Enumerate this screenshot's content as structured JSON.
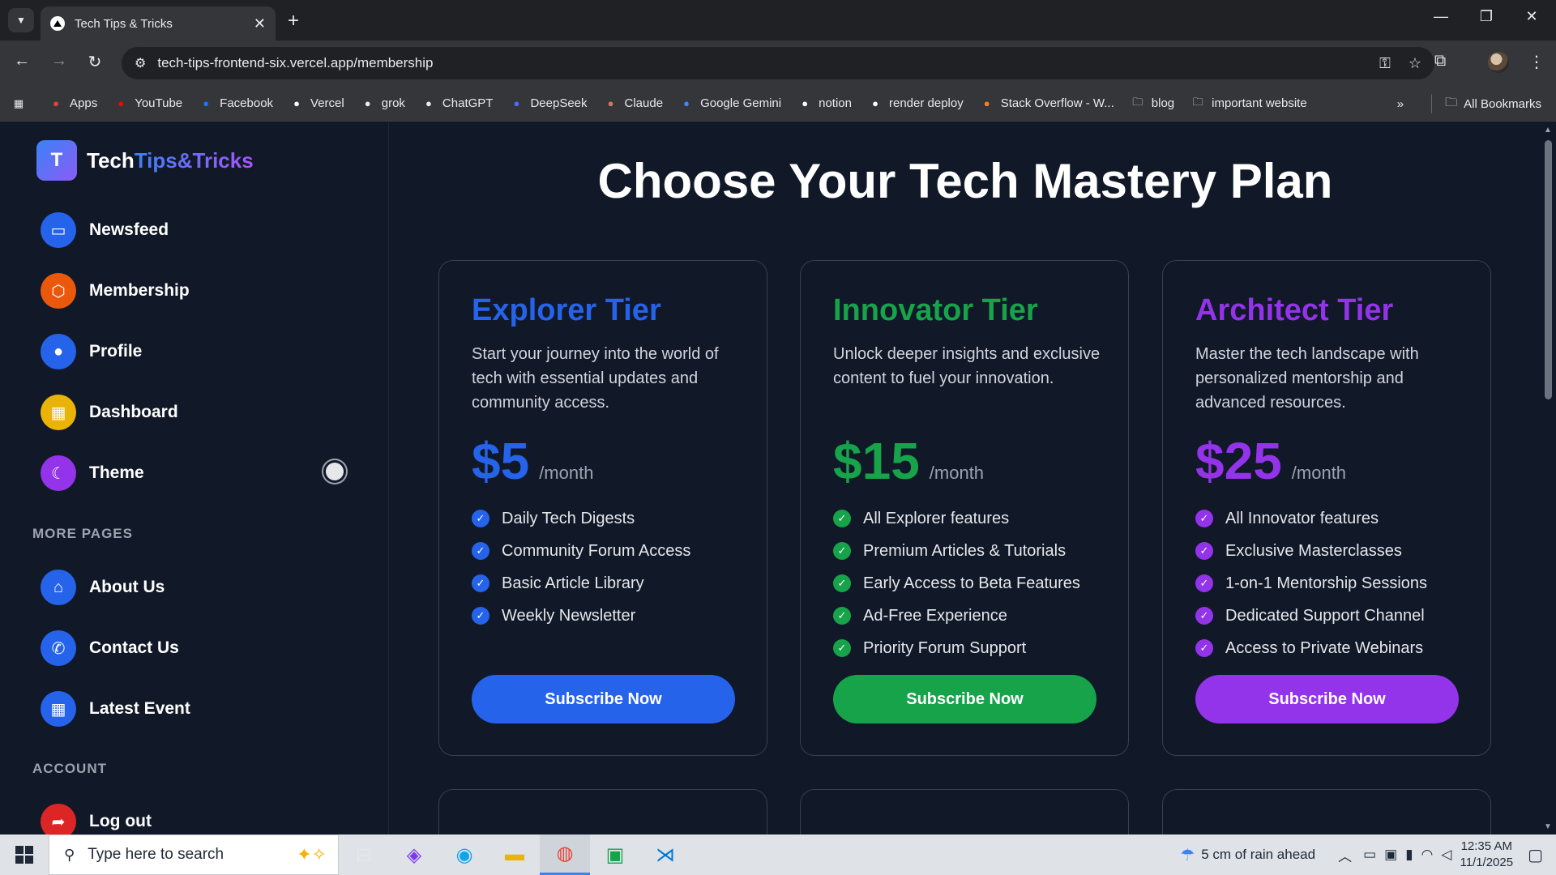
{
  "browser": {
    "tab_title": "Tech Tips & Tricks",
    "url": "tech-tips-frontend-six.vercel.app/membership",
    "bookmarks": [
      {
        "label": "Apps",
        "icon": "apps-grid-icon",
        "color": "#ea4335"
      },
      {
        "label": "YouTube",
        "icon": "youtube-icon",
        "color": "#ff0000"
      },
      {
        "label": "Facebook",
        "icon": "facebook-icon",
        "color": "#1877f2"
      },
      {
        "label": "Vercel",
        "icon": "vercel-icon",
        "color": "#ffffff"
      },
      {
        "label": "grok",
        "icon": "grok-icon",
        "color": "#e8eaed"
      },
      {
        "label": "ChatGPT",
        "icon": "chatgpt-icon",
        "color": "#e8eaed"
      },
      {
        "label": "DeepSeek",
        "icon": "deepseek-icon",
        "color": "#4d6bfe"
      },
      {
        "label": "Claude",
        "icon": "claude-icon",
        "color": "#d97757"
      },
      {
        "label": "Google Gemini",
        "icon": "gemini-icon",
        "color": "#4285f4"
      },
      {
        "label": "notion",
        "icon": "notion-icon",
        "color": "#ffffff"
      },
      {
        "label": "render deploy",
        "icon": "render-icon",
        "color": "#ffffff"
      },
      {
        "label": "Stack Overflow - W...",
        "icon": "stackoverflow-icon",
        "color": "#f48024"
      },
      {
        "label": "blog",
        "icon": "folder-icon",
        "color": "#e8eaed"
      },
      {
        "label": "important website",
        "icon": "folder-icon",
        "color": "#e8eaed"
      }
    ],
    "all_bookmarks": "All Bookmarks"
  },
  "sidebar": {
    "brand_part1": "Tech",
    "brand_part2": "Tips&Tricks",
    "logo_letter": "T",
    "items": [
      {
        "label": "Newsfeed",
        "icon": "monitor-icon",
        "color": "#2563eb"
      },
      {
        "label": "Membership",
        "icon": "cube-icon",
        "color": "#ea580c"
      },
      {
        "label": "Profile",
        "icon": "user-circle-icon",
        "color": "#2563eb"
      },
      {
        "label": "Dashboard",
        "icon": "grid-icon",
        "color": "#eab308"
      },
      {
        "label": "Theme",
        "icon": "moon-icon",
        "color": "#9333ea"
      }
    ],
    "more_pages_title": "MORE PAGES",
    "more_pages": [
      {
        "label": "About Us",
        "icon": "home-hand-icon",
        "color": "#2563eb"
      },
      {
        "label": "Contact Us",
        "icon": "phone-icon",
        "color": "#2563eb"
      },
      {
        "label": "Latest Event",
        "icon": "calendar-icon",
        "color": "#2563eb"
      }
    ],
    "account_title": "ACCOUNT",
    "logout": {
      "label": "Log out",
      "icon": "logout-icon",
      "color": "#dc2626"
    }
  },
  "main": {
    "heading": "Choose Your Tech Mastery Plan",
    "tiers": [
      {
        "name": "Explorer Tier",
        "color": "#2563eb",
        "description": "Start your journey into the world of tech with essential updates and community access.",
        "price": "$5",
        "period": "/month",
        "features": [
          "Daily Tech Digests",
          "Community Forum Access",
          "Basic Article Library",
          "Weekly Newsletter"
        ],
        "button": "Subscribe Now"
      },
      {
        "name": "Innovator Tier",
        "color": "#16a34a",
        "description": "Unlock deeper insights and exclusive content to fuel your innovation.",
        "price": "$15",
        "period": "/month",
        "features": [
          "All Explorer features",
          "Premium Articles & Tutorials",
          "Early Access to Beta Features",
          "Ad-Free Experience",
          "Priority Forum Support"
        ],
        "button": "Subscribe Now"
      },
      {
        "name": "Architect Tier",
        "color": "#9333ea",
        "description": "Master the tech landscape with personalized mentorship and advanced resources.",
        "price": "$25",
        "period": "/month",
        "features": [
          "All Innovator features",
          "Exclusive Masterclasses",
          "1-on-1 Mentorship Sessions",
          "Dedicated Support Channel",
          "Access to Private Webinars"
        ],
        "button": "Subscribe Now"
      }
    ],
    "next_row_colors": [
      "#ca8a04",
      "#dc2626",
      "#dc2626"
    ]
  },
  "taskbar": {
    "search_placeholder": "Type here to search",
    "weather": "5 cm of rain ahead",
    "time": "12:35 AM",
    "date": "11/1/2025"
  }
}
